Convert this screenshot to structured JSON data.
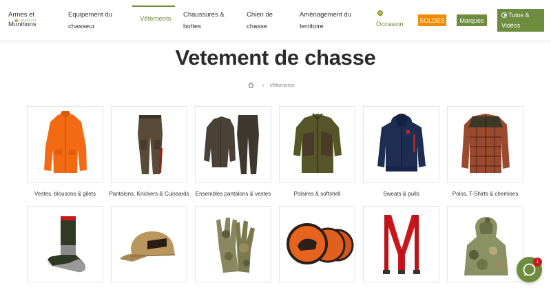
{
  "nav": {
    "items": [
      {
        "label_line1": "Armes et",
        "label_line2": "Munitions"
      },
      {
        "label_line1": "Equipement du",
        "label_line2": "chasseur"
      },
      {
        "label_line1": "Vêtements",
        "label_line2": ""
      },
      {
        "label_line1": "Chaussures &",
        "label_line2": "bottes"
      },
      {
        "label_line1": "Chien de",
        "label_line2": "chasse"
      },
      {
        "label_line1": "Aménagement du",
        "label_line2": "territoire"
      }
    ],
    "logo_small": "CHASSEURS",
    "occasion": "Occasion",
    "soldes": "SOLDES",
    "marques": "Marques",
    "tutos_line1": "Tutos &",
    "tutos_line2": "Vidéos",
    "active_color": "#6e8c3e",
    "soldes_color": "#f08a00"
  },
  "page": {
    "title": "Vetement de chasse",
    "breadcrumb_current": "Vêtements"
  },
  "categories": [
    {
      "label": "Vestes, blousons & gilets",
      "icon": "orange-jacket"
    },
    {
      "label": "Pantalons, Knickers & Cuissards",
      "icon": "brown-trousers"
    },
    {
      "label": "Ensembles pantalons & vestes",
      "icon": "jacket-trousers-set"
    },
    {
      "label": "Polaires & softshell",
      "icon": "green-fleece"
    },
    {
      "label": "Sweats & pulls",
      "icon": "navy-hoodie"
    },
    {
      "label": "Polos, T-Shirts & chemises",
      "icon": "plaid-shirt"
    },
    {
      "label": "",
      "icon": "socks"
    },
    {
      "label": "",
      "icon": "cap"
    },
    {
      "label": "",
      "icon": "camo-gloves"
    },
    {
      "label": "",
      "icon": "patches"
    },
    {
      "label": "",
      "icon": "suspenders"
    },
    {
      "label": "",
      "icon": "camo-hood"
    }
  ],
  "chat": {
    "badge": "1"
  }
}
